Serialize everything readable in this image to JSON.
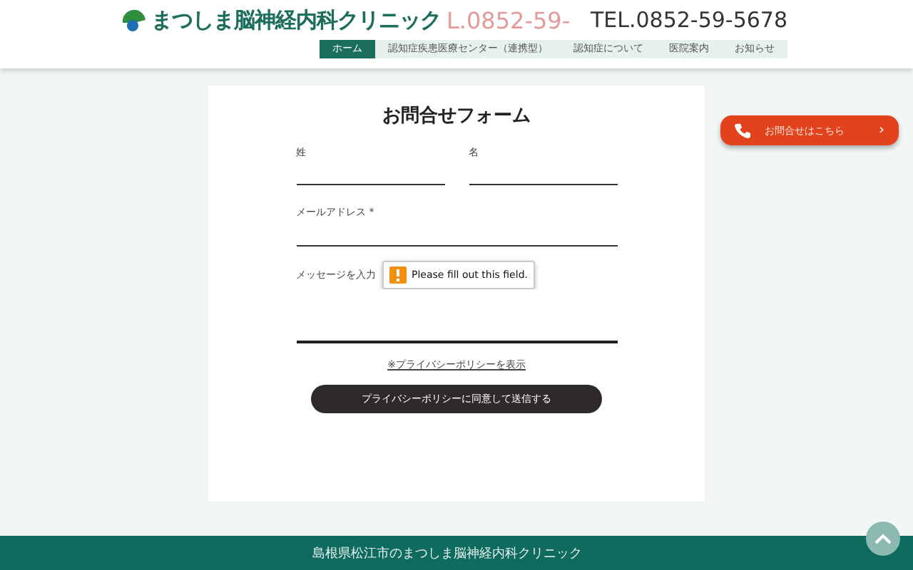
{
  "header": {
    "clinic_name": "まつしま脳神経内科クリニック",
    "ghost_text": "L.0852-59-",
    "tel": "TEL.0852-59-5678"
  },
  "nav": [
    {
      "label": "ホーム",
      "selected": true
    },
    {
      "label": "認知症疾患医療センター（連携型）",
      "selected": false
    },
    {
      "label": "認知症について",
      "selected": false
    },
    {
      "label": "医院案内",
      "selected": false
    },
    {
      "label": "お知らせ",
      "selected": false
    }
  ],
  "form": {
    "title": "お問合せフォーム",
    "last_name_label": "姓",
    "first_name_label": "名",
    "email_label": "メールアドレス *",
    "message_label": "メッセージを入力",
    "tooltip": "Please fill out this field.",
    "privacy_link": "※プライバシーポリシーを表示",
    "submit": "プライバシーポリシーに同意して送信する"
  },
  "contact_button": "お問合せはこちら",
  "contact_chevron": "›",
  "footer": {
    "text": "島根県松江市のまつしま脳神経内科クリニック"
  }
}
